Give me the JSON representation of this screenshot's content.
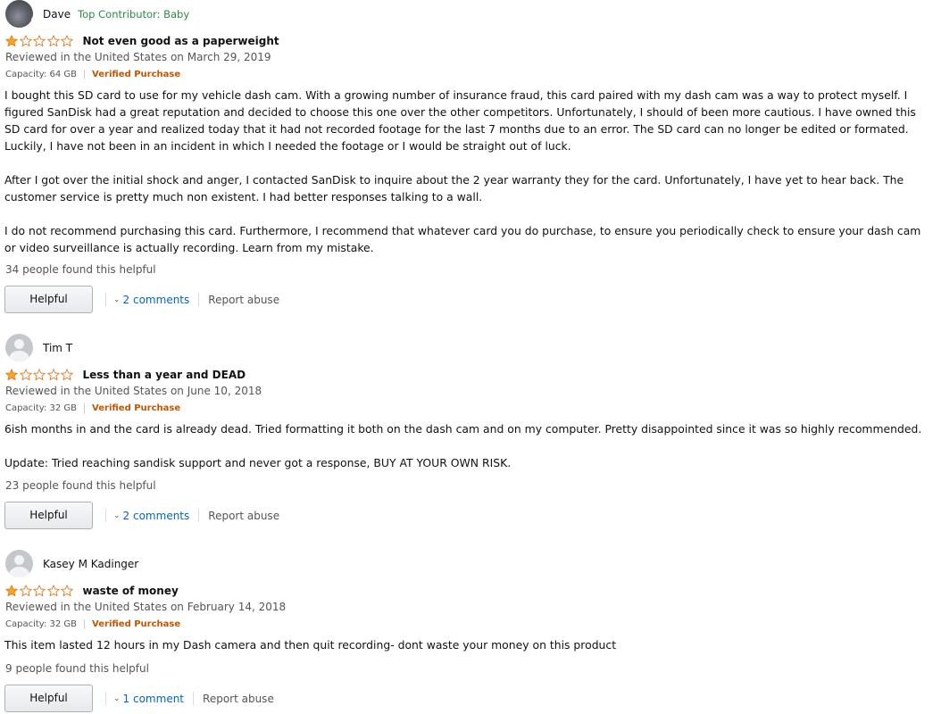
{
  "colors": {
    "star_fill": "#ffa41c",
    "star_outline": "#de7921",
    "verified": "#c45500",
    "link": "#0066c0",
    "contributor_badge": "#2e8b45"
  },
  "reviews": [
    {
      "author": "Dave",
      "author_badge": "Top Contributor: Baby",
      "avatar": "photo-avatar",
      "rating": 1,
      "title": "Not even good as a paperweight",
      "date": "Reviewed in the United States on March 29, 2019",
      "capacity": "Capacity: 64 GB",
      "verified": "Verified Purchase",
      "paragraphs": [
        "I bought this SD card to use for my vehicle dash cam. With a growing number of insurance fraud, this card paired with my dash cam was a way to protect myself. I figured SanDisk had a great reputation and decided to choose this one over the other competitors. Unfortunately, I should of been more cautious. I have owned this SD card for over a year and realized today that it had not recorded footage for the last 7 months due to an error. The SD card can no longer be edited or formated. Luckily, I have not been in an incident in which I needed the footage or I would be straight out of luck.",
        "After I got over the initial shock and anger, I contacted SanDisk to inquire about the 2 year warranty they for the card. Unfortunately, I have yet to hear back. The customer service is pretty much non existent. I had better responses talking to a wall.",
        "I do not recommend purchasing this card. Furthermore, I recommend that whatever card you do purchase, to ensure you periodically check to ensure your dash cam or video surveillance is actually recording. Learn from my mistake."
      ],
      "helpful_count": "34 people found this helpful",
      "helpful_label": "Helpful",
      "comments": "2 comments",
      "report": "Report abuse"
    },
    {
      "author": "Tim T",
      "author_badge": "",
      "avatar": "default-avatar",
      "rating": 1,
      "title": "Less than a year and DEAD",
      "date": "Reviewed in the United States on June 10, 2018",
      "capacity": "Capacity: 32 GB",
      "verified": "Verified Purchase",
      "paragraphs": [
        "6ish months in and the card is already dead. Tried formatting it both on the dash cam and on my computer. Pretty disappointed since it was so highly recommended.",
        "Update: Tried reaching sandisk support and never got a response, BUY AT YOUR OWN RISK."
      ],
      "helpful_count": "23 people found this helpful",
      "helpful_label": "Helpful",
      "comments": "2 comments",
      "report": "Report abuse"
    },
    {
      "author": "Kasey M Kadinger",
      "author_badge": "",
      "avatar": "default-avatar",
      "rating": 1,
      "title": "waste of money",
      "date": "Reviewed in the United States on February 14, 2018",
      "capacity": "Capacity: 32 GB",
      "verified": "Verified Purchase",
      "paragraphs": [
        "This item lasted 12 hours in my Dash camera and then quit recording- dont waste your money on this product"
      ],
      "helpful_count": "9 people found this helpful",
      "helpful_label": "Helpful",
      "comments": "1 comment",
      "report": "Report abuse"
    }
  ]
}
